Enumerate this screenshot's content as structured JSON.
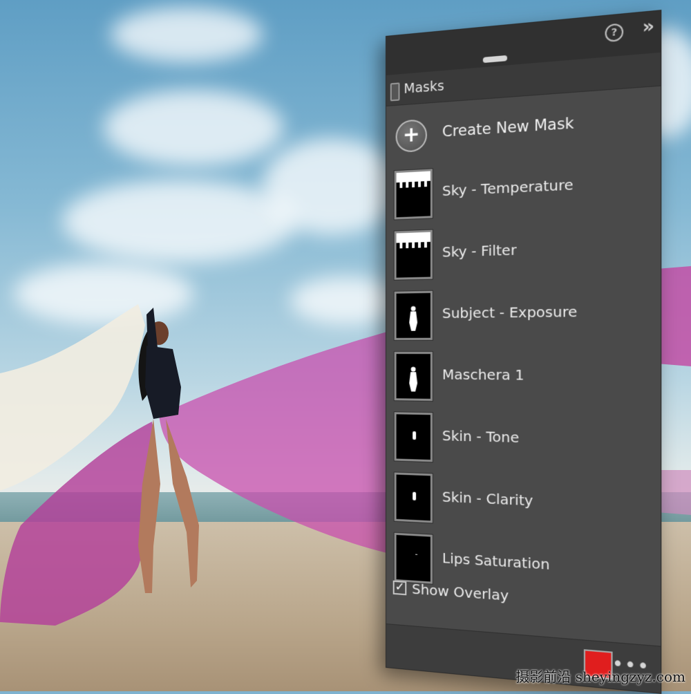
{
  "panel": {
    "title": "Masks",
    "help_icon": "?",
    "collapse_icon": "»",
    "create_label": "Create New Mask",
    "add_icon": "+",
    "masks": [
      {
        "label": "Sky - Temperature",
        "thumb": "sky"
      },
      {
        "label": "Sky - Filter",
        "thumb": "sky"
      },
      {
        "label": "Subject - Exposure",
        "thumb": "subject"
      },
      {
        "label": "Maschera 1",
        "thumb": "subject"
      },
      {
        "label": "Skin - Tone",
        "thumb": "skin"
      },
      {
        "label": "Skin - Clarity",
        "thumb": "skin"
      },
      {
        "label": "Lips Saturation",
        "thumb": "lips"
      }
    ],
    "show_overlay": {
      "label": "Show Overlay",
      "checked": true,
      "check_glyph": "✓"
    },
    "overlay_color": "#e01e1e",
    "more_icon": "•••"
  },
  "watermark": "摄影前沿 sheyingzyz.com"
}
